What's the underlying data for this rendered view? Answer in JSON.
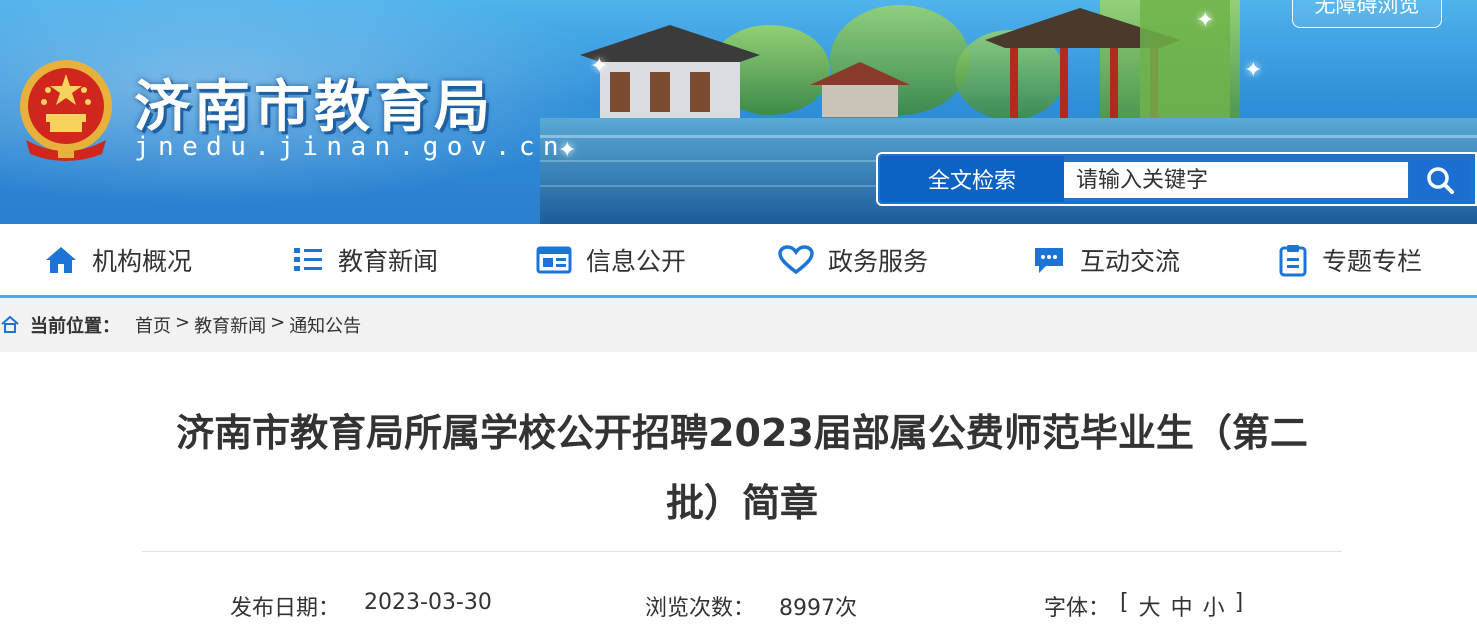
{
  "header": {
    "site_title": "济南市教育局",
    "site_domain": "jnedu.jinan.gov.cn",
    "accessibility_button": "无障碍浏览",
    "search": {
      "label": "全文检索",
      "placeholder": "请输入关键字"
    }
  },
  "nav": {
    "items": [
      {
        "label": "机构概况",
        "icon": "home-icon"
      },
      {
        "label": "教育新闻",
        "icon": "list-icon"
      },
      {
        "label": "信息公开",
        "icon": "document-icon"
      },
      {
        "label": "政务服务",
        "icon": "heart-icon"
      },
      {
        "label": "互动交流",
        "icon": "chat-icon"
      },
      {
        "label": "专题专栏",
        "icon": "clipboard-icon"
      }
    ],
    "accent_color": "#1b74d6"
  },
  "breadcrumb": {
    "label": "当前位置：",
    "items": [
      "首页",
      "教育新闻",
      "通知公告"
    ],
    "separator": ">"
  },
  "article": {
    "title_line1": "济南市教育局所属学校公开招聘2023届部属公费师范毕业生（第二",
    "title_line2": "批）简章",
    "publish_label": "发布日期：",
    "publish_date": "2023-03-30",
    "views_label": "浏览次数：",
    "views_value": "8997次",
    "font_label": "字体：",
    "font_open": "[",
    "font_large": "大",
    "font_medium": "中",
    "font_small": "小",
    "font_close": "]"
  }
}
